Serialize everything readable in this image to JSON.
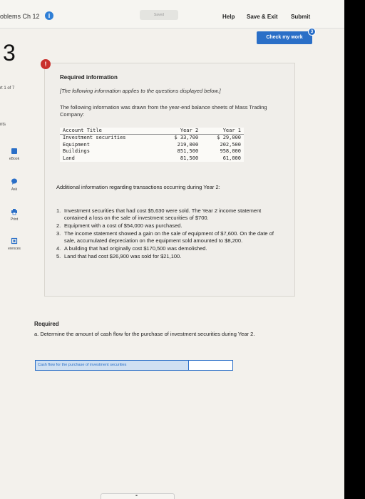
{
  "topbar": {
    "title": "oblems Ch 12",
    "info_icon": "i",
    "saved": "Saved",
    "help": "Help",
    "save_exit": "Save & Exit",
    "submit": "Submit"
  },
  "check_button": {
    "label": "Check my work",
    "badge": "3"
  },
  "question": {
    "number": "3",
    "part": "rt 1 of 7",
    "points": "nts"
  },
  "sidebar": {
    "items": [
      {
        "label": "eBook",
        "icon": "book-icon"
      },
      {
        "label": "Ask",
        "icon": "chat-icon"
      },
      {
        "label": "Print",
        "icon": "print-icon"
      },
      {
        "label": "erences",
        "icon": "references-icon"
      }
    ]
  },
  "info_panel": {
    "alert": "!",
    "heading": "Required information",
    "italic_note": "[The following information applies to the questions displayed below.]",
    "intro": "The following information was drawn from the year-end balance sheets of Mass Trading Company:",
    "table": {
      "headers": [
        "Account Title",
        "Year 2",
        "Year 1"
      ],
      "rows": [
        [
          "Investment securities",
          "$ 33,700",
          "$ 29,000"
        ],
        [
          "Equipment",
          "219,000",
          "202,500"
        ],
        [
          "Buildings",
          "851,500",
          "958,000"
        ],
        [
          "Land",
          "81,500",
          "61,000"
        ]
      ]
    },
    "additional_heading": "Additional information regarding transactions occurring during Year 2:",
    "transactions": [
      "Investment securities that had cost $5,630 were sold. The Year 2 income statement contained a loss on the sale of investment securities of $700.",
      "Equipment with a cost of $54,000 was purchased.",
      "The income statement showed a gain on the sale of equipment of $7,600. On the date of sale, accumulated depreciation on the equipment sold amounted to $8,200.",
      "A building that had originally cost $170,500 was demolished.",
      "Land that had cost $26,900 was sold for $21,100."
    ]
  },
  "required": {
    "heading": "Required",
    "text": "a. Determine the amount of cash flow for the purchase of investment securities during Year 2."
  },
  "answer": {
    "label": "Cash flow for the purchase of investment securities",
    "value": ""
  }
}
